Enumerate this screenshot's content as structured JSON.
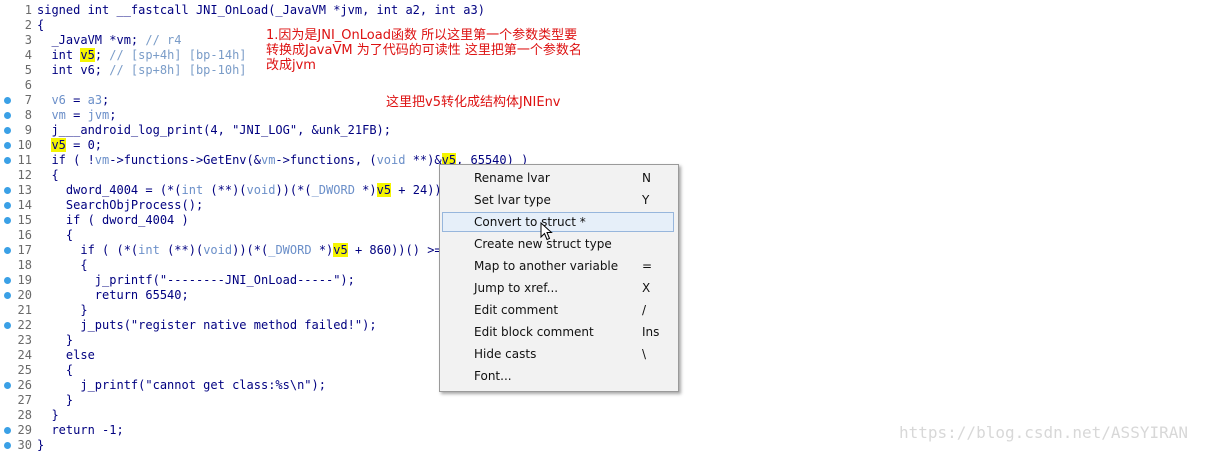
{
  "lines": [
    {
      "n": "1",
      "bp": false,
      "parts": [
        {
          "t": "signed int __fastcall JNI_OnLoad(_JavaVM *jvm, int a2, int a3)",
          "c": ""
        }
      ]
    },
    {
      "n": "2",
      "bp": false,
      "parts": [
        {
          "t": "{",
          "c": ""
        }
      ]
    },
    {
      "n": "3",
      "bp": false,
      "parts": [
        {
          "t": "  _JavaVM *vm; ",
          "c": ""
        },
        {
          "t": "// r4",
          "c": "cm"
        }
      ]
    },
    {
      "n": "4",
      "bp": false,
      "parts": [
        {
          "t": "  int ",
          "c": ""
        },
        {
          "t": "v5",
          "c": "hl"
        },
        {
          "t": "; ",
          "c": ""
        },
        {
          "t": "// [sp+4h] [bp-14h]",
          "c": "cm"
        }
      ]
    },
    {
      "n": "5",
      "bp": false,
      "parts": [
        {
          "t": "  int v6; ",
          "c": ""
        },
        {
          "t": "// [sp+8h] [bp-10h]",
          "c": "cm"
        }
      ]
    },
    {
      "n": "6",
      "bp": false,
      "parts": [
        {
          "t": "",
          "c": ""
        }
      ]
    },
    {
      "n": "7",
      "bp": true,
      "parts": [
        {
          "t": "  ",
          "c": ""
        },
        {
          "t": "v6",
          "c": "vg"
        },
        {
          "t": " = ",
          "c": ""
        },
        {
          "t": "a3",
          "c": "vg"
        },
        {
          "t": ";",
          "c": ""
        }
      ]
    },
    {
      "n": "8",
      "bp": true,
      "parts": [
        {
          "t": "  ",
          "c": ""
        },
        {
          "t": "vm",
          "c": "vg"
        },
        {
          "t": " = ",
          "c": ""
        },
        {
          "t": "jvm",
          "c": "vg"
        },
        {
          "t": ";",
          "c": ""
        }
      ]
    },
    {
      "n": "9",
      "bp": true,
      "parts": [
        {
          "t": "  j___android_log_print(4, \"JNI_LOG\", &unk_21FB);",
          "c": ""
        }
      ]
    },
    {
      "n": "10",
      "bp": true,
      "parts": [
        {
          "t": "  ",
          "c": ""
        },
        {
          "t": "v5",
          "c": "hl"
        },
        {
          "t": " = 0;",
          "c": ""
        }
      ]
    },
    {
      "n": "11",
      "bp": true,
      "parts": [
        {
          "t": "  if ( !",
          "c": ""
        },
        {
          "t": "vm",
          "c": "vg"
        },
        {
          "t": "->functions->GetEnv(&",
          "c": ""
        },
        {
          "t": "vm",
          "c": "vg"
        },
        {
          "t": "->functions, (",
          "c": ""
        },
        {
          "t": "void",
          "c": "vg"
        },
        {
          "t": " **)&",
          "c": ""
        },
        {
          "t": "v5",
          "c": "hl"
        },
        {
          "t": ", 65540) )",
          "c": ""
        }
      ]
    },
    {
      "n": "12",
      "bp": false,
      "parts": [
        {
          "t": "  {",
          "c": ""
        }
      ]
    },
    {
      "n": "13",
      "bp": true,
      "parts": [
        {
          "t": "    dword_4004 = (*(",
          "c": ""
        },
        {
          "t": "int",
          "c": "vg"
        },
        {
          "t": " (**)(",
          "c": ""
        },
        {
          "t": "void",
          "c": "vg"
        },
        {
          "t": "))(*(",
          "c": ""
        },
        {
          "t": "_DWORD",
          "c": "vg"
        },
        {
          "t": " *)",
          "c": ""
        },
        {
          "t": "v5",
          "c": "hl"
        },
        {
          "t": " + 24))(",
          "c": ""
        }
      ]
    },
    {
      "n": "14",
      "bp": true,
      "parts": [
        {
          "t": "    SearchObjProcess();",
          "c": ""
        }
      ]
    },
    {
      "n": "15",
      "bp": true,
      "parts": [
        {
          "t": "    if ( dword_4004 )",
          "c": ""
        }
      ]
    },
    {
      "n": "16",
      "bp": false,
      "parts": [
        {
          "t": "    {",
          "c": ""
        }
      ]
    },
    {
      "n": "17",
      "bp": true,
      "parts": [
        {
          "t": "      if ( (*(",
          "c": ""
        },
        {
          "t": "int",
          "c": "vg"
        },
        {
          "t": " (**)(",
          "c": ""
        },
        {
          "t": "void",
          "c": "vg"
        },
        {
          "t": "))(*(",
          "c": ""
        },
        {
          "t": "_DWORD",
          "c": "vg"
        },
        {
          "t": " *)",
          "c": ""
        },
        {
          "t": "v5",
          "c": "hl"
        },
        {
          "t": " + 860))() >= 0",
          "c": ""
        }
      ]
    },
    {
      "n": "18",
      "bp": false,
      "parts": [
        {
          "t": "      {",
          "c": ""
        }
      ]
    },
    {
      "n": "19",
      "bp": true,
      "parts": [
        {
          "t": "        j_printf(\"--------JNI_OnLoad-----\");",
          "c": ""
        }
      ]
    },
    {
      "n": "20",
      "bp": true,
      "parts": [
        {
          "t": "        return 65540;",
          "c": ""
        }
      ]
    },
    {
      "n": "21",
      "bp": false,
      "parts": [
        {
          "t": "      }",
          "c": ""
        }
      ]
    },
    {
      "n": "22",
      "bp": true,
      "parts": [
        {
          "t": "      j_puts(\"register native method failed!\");",
          "c": ""
        }
      ]
    },
    {
      "n": "23",
      "bp": false,
      "parts": [
        {
          "t": "    }",
          "c": ""
        }
      ]
    },
    {
      "n": "24",
      "bp": false,
      "parts": [
        {
          "t": "    else",
          "c": ""
        }
      ]
    },
    {
      "n": "25",
      "bp": false,
      "parts": [
        {
          "t": "    {",
          "c": ""
        }
      ]
    },
    {
      "n": "26",
      "bp": true,
      "parts": [
        {
          "t": "      j_printf(\"cannot get class:%s\\n\");",
          "c": ""
        }
      ]
    },
    {
      "n": "27",
      "bp": false,
      "parts": [
        {
          "t": "    }",
          "c": ""
        }
      ]
    },
    {
      "n": "28",
      "bp": false,
      "parts": [
        {
          "t": "  }",
          "c": ""
        }
      ]
    },
    {
      "n": "29",
      "bp": true,
      "parts": [
        {
          "t": "  return -1;",
          "c": ""
        }
      ]
    },
    {
      "n": "30",
      "bp": true,
      "parts": [
        {
          "t": "}",
          "c": ""
        }
      ]
    }
  ],
  "annotations": {
    "note1": "1.因为是JNI_OnLoad函数 所以这里第一个参数类型要\n转换成JavaVM 为了代码的可读性 这里把第一个参数名\n改成jvm",
    "note2": "这里把v5转化成结构体JNIEnv"
  },
  "context_menu": {
    "selected_index": 2,
    "items": [
      {
        "label": "Rename lvar",
        "key": "N"
      },
      {
        "label": "Set lvar type",
        "key": "Y"
      },
      {
        "label": "Convert to struct *",
        "key": ""
      },
      {
        "label": "Create new struct type",
        "key": ""
      },
      {
        "label": "Map to another variable",
        "key": "="
      },
      {
        "label": "Jump to xref...",
        "key": "X"
      },
      {
        "label": "Edit comment",
        "key": "/"
      },
      {
        "label": "Edit block comment",
        "key": "Ins"
      },
      {
        "label": "Hide casts",
        "key": "\\"
      },
      {
        "label": "Font...",
        "key": ""
      }
    ]
  },
  "watermark": "https://blog.csdn.net/ASSYIRAN",
  "colors": {
    "code_text": "#000080",
    "variable_gray": "#6b8fc9",
    "highlight": "#f5f500",
    "note_red": "#dd1111",
    "breakpoint_dot": "#3aa0e6"
  }
}
